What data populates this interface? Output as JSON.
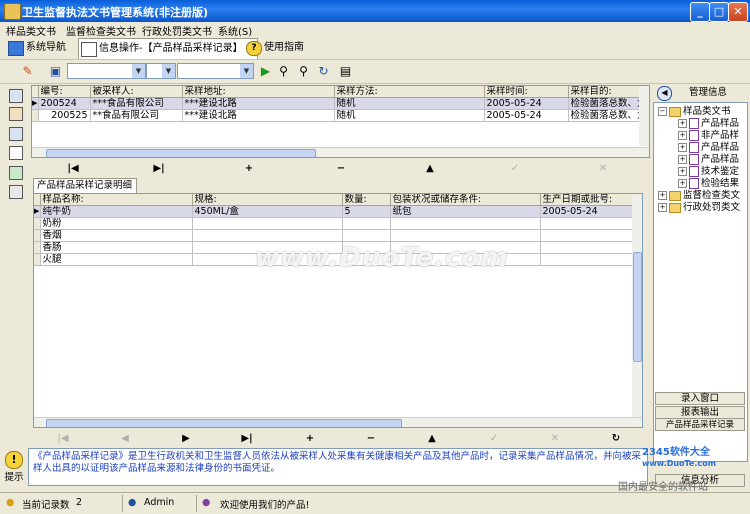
{
  "window": {
    "title": "卫生监督执法文书管理系统(非注册版)",
    "min": "_",
    "max": "□",
    "close": "✕"
  },
  "menu": [
    "样品类文书",
    "监督检查类文书",
    "行政处罚类文书",
    "系统(S)"
  ],
  "nav": {
    "system_nav": "系统导航",
    "info_op": "信息操作-【产品样品采样记录】",
    "guide": "使用指南"
  },
  "master": {
    "columns": [
      "编号:",
      "被采样人:",
      "采样地址:",
      "采样方法:",
      "采样时间:",
      "采样目的:"
    ],
    "rows": [
      [
        "200524",
        "***食品有限公司",
        "***建设北路",
        "随机",
        "2005-05-24",
        "检验菌落总数、大"
      ],
      [
        "200525",
        "**食品有限公司",
        "***建设北路",
        "随机",
        "2005-05-24",
        "检验菌落总数、大"
      ]
    ]
  },
  "nav_buttons": {
    "first": "|◀",
    "last": "▶|",
    "add": "+",
    "del": "−",
    "up": "▲",
    "check": "✓",
    "x": "✕"
  },
  "detail_tab": "产品样品采样记录明细表",
  "detail": {
    "columns": [
      "样品名称:",
      "规格:",
      "数量:",
      "包装状况或储存条件:",
      "生产日期或批号:"
    ],
    "rows": [
      [
        "纯牛奶",
        "450ML/盒",
        "5",
        "纸包",
        "2005-05-24"
      ],
      [
        "奶粉",
        "",
        "",
        "",
        ""
      ],
      [
        "香烟",
        "",
        "",
        "",
        ""
      ],
      [
        "香肠",
        "",
        "",
        "",
        ""
      ],
      [
        "火腿",
        "",
        "",
        "",
        ""
      ]
    ]
  },
  "detail_nav": {
    "first": "|◀",
    "prev": "◀",
    "next": "▶",
    "last": "▶|",
    "add": "+",
    "del": "−",
    "up": "▲",
    "check": "✓",
    "x": "✕",
    "refresh": "↻"
  },
  "tree": {
    "header": "管理信息",
    "nodes": [
      {
        "label": "样品类文书",
        "level": 1,
        "kind": "folder"
      },
      {
        "label": "产品样品",
        "level": 2,
        "kind": "doc"
      },
      {
        "label": "非产品样",
        "level": 2,
        "kind": "doc"
      },
      {
        "label": "产品样品",
        "level": 2,
        "kind": "doc"
      },
      {
        "label": "产品样品",
        "level": 2,
        "kind": "doc"
      },
      {
        "label": "技术鉴定",
        "level": 2,
        "kind": "doc"
      },
      {
        "label": "检验结果",
        "level": 2,
        "kind": "doc"
      },
      {
        "label": "监督检查类文",
        "level": 1,
        "kind": "folder"
      },
      {
        "label": "行政处罚类文",
        "level": 1,
        "kind": "folder"
      }
    ],
    "buttons": [
      "录入窗口",
      "报表输出",
      "产品样品采样记录"
    ]
  },
  "info": {
    "label": "提示",
    "text": "《产品样品采样记录》是卫生行政机关和卫生监督人员依法从被采样人处采集有关健康相关产品及其他产品时，记录采集产品样品情况，并向被采样人出具的以证明该产品样品来源和法律身份的书面凭证。"
  },
  "status": {
    "records_label": "当前记录数",
    "records": "2",
    "user": "Admin",
    "welcome": "欢迎使用我们的产品!",
    "analysis": "信息分析"
  },
  "watermark": {
    "main": "www.DuoTe.com",
    "site": "www.DuoTe.com",
    "brand": "2345软件大全",
    "footer": "国内最安全的软件站"
  }
}
